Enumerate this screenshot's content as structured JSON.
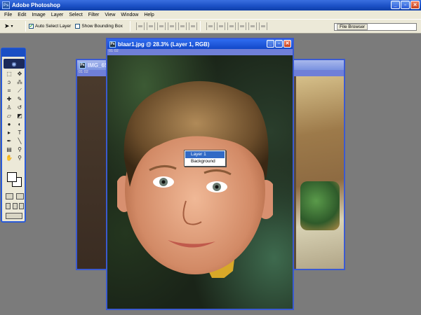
{
  "app": {
    "title": "Adobe Photoshop",
    "logo": "Ps"
  },
  "window_controls": {
    "minimize": "_",
    "restore": "▫",
    "close": "✕"
  },
  "menu": [
    "File",
    "Edit",
    "Image",
    "Layer",
    "Select",
    "Filter",
    "View",
    "Window",
    "Help"
  ],
  "options": {
    "auto_select_label": "Auto Select Layer",
    "auto_select_checked": true,
    "bounding_box_label": "Show Bounding Box",
    "bounding_box_checked": false,
    "file_browser_label": "File Browser"
  },
  "documents": {
    "front": {
      "title": "blaar1.jpg @ 28.3% (Layer 1, RGB)",
      "ruler": "01 02"
    },
    "back": {
      "title": "IMG_65",
      "ruler": "01 02"
    }
  },
  "context_menu": {
    "items": [
      "Layer 1",
      "Background"
    ],
    "selected": "Layer 1"
  },
  "colors": {
    "accent": "#1248c8",
    "menu_highlight": "#316ac5",
    "workspace": "#7b7b7b"
  },
  "icons": [
    "move-tool-icon",
    "marquee-tool-icon",
    "lasso-tool-icon",
    "crop-tool-icon",
    "brush-tool-icon",
    "eraser-tool-icon",
    "type-tool-icon",
    "hand-tool-icon",
    "zoom-tool-icon"
  ]
}
